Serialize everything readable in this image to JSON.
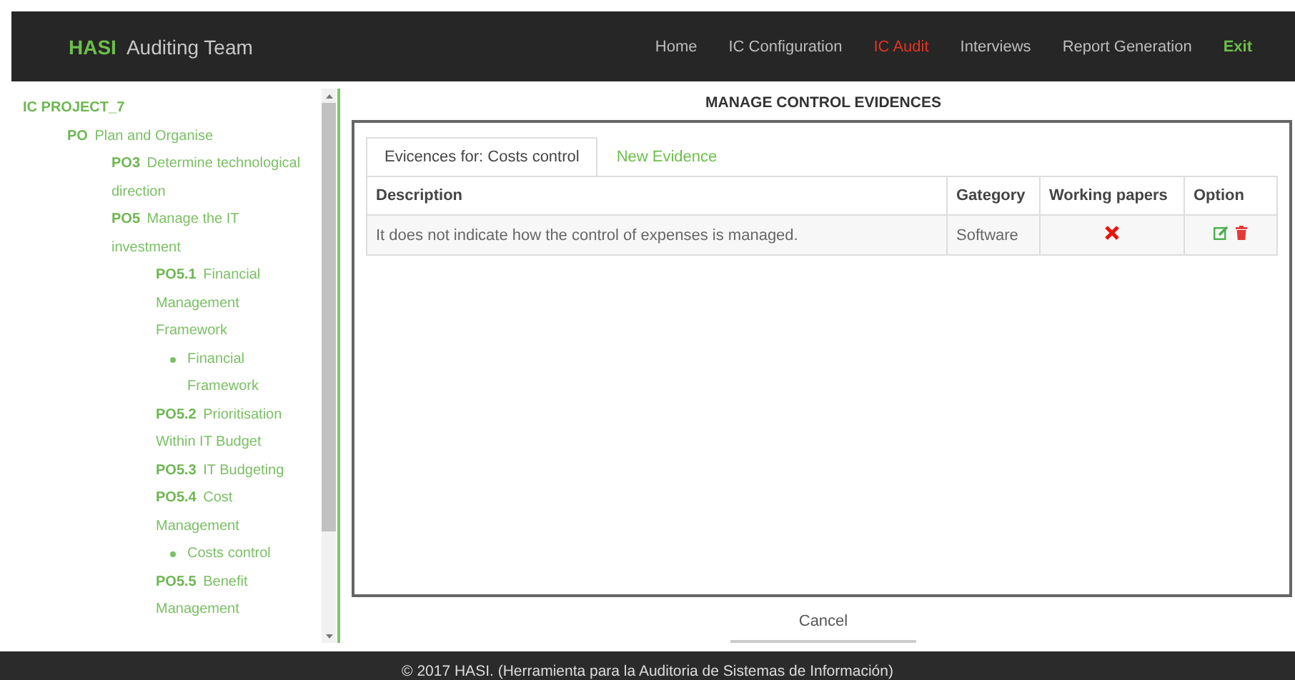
{
  "brand": {
    "name": "HASI",
    "subtitle": "Auditing Team"
  },
  "nav": [
    {
      "label": "Home",
      "selected": false,
      "kind": "link"
    },
    {
      "label": "IC Configuration",
      "selected": false,
      "kind": "link"
    },
    {
      "label": "IC Audit",
      "selected": true,
      "kind": "link"
    },
    {
      "label": "Interviews",
      "selected": false,
      "kind": "link"
    },
    {
      "label": "Report Generation",
      "selected": false,
      "kind": "link"
    },
    {
      "label": "Exit",
      "selected": false,
      "kind": "exit"
    }
  ],
  "tree": {
    "title": "IC PROJECT_7",
    "children": [
      {
        "kind": "node",
        "code": "PO",
        "title": "Plan and Organise",
        "children": [
          {
            "kind": "node",
            "code": "PO3",
            "title": "Determine technological direction"
          },
          {
            "kind": "node",
            "code": "PO5",
            "title": "Manage the IT investment",
            "children": [
              {
                "kind": "node",
                "code": "PO5.1",
                "title": "Financial Management Framework",
                "children": [
                  {
                    "kind": "bullet",
                    "title": "Financial Framework"
                  }
                ]
              },
              {
                "kind": "node",
                "code": "PO5.2",
                "title": "Prioritisation Within IT Budget"
              },
              {
                "kind": "node",
                "code": "PO5.3",
                "title": "IT Budgeting"
              },
              {
                "kind": "node",
                "code": "PO5.4",
                "title": "Cost Management",
                "children": [
                  {
                    "kind": "bullet",
                    "title": "Costs control"
                  }
                ]
              },
              {
                "kind": "node",
                "code": "PO5.5",
                "title": "Benefit Management"
              }
            ]
          }
        ]
      }
    ]
  },
  "panel": {
    "title": "MANAGE CONTROL EVIDENCES",
    "tabs": [
      {
        "label": "Evicences for: Costs control",
        "selected": true
      },
      {
        "label": "New Evidence",
        "selected": false
      }
    ],
    "table": {
      "columns": [
        "Description",
        "Gategory",
        "Working papers",
        "Option"
      ],
      "rows": [
        {
          "description": "It does not indicate how the control of expenses is managed.",
          "category": "Software",
          "working_papers": false
        }
      ]
    },
    "cancel": "Cancel"
  },
  "footer": "© 2017 HASI. (Herramienta para la Auditoria de Sistemas de Información)"
}
